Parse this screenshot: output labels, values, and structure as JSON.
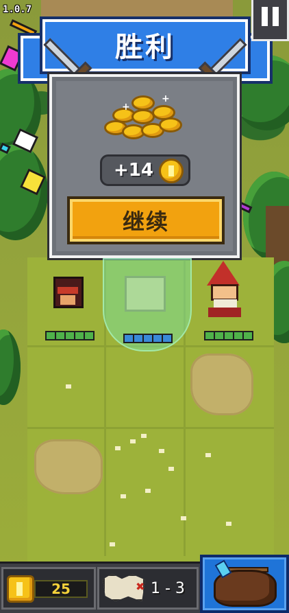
{
  "game": {
    "version": "1.0.7",
    "banner_title": "胜利",
    "reward": {
      "amount_label": "+14",
      "icon": "gold-coin-icon"
    },
    "continue_label": "继续",
    "pause_icon": "pause-icon"
  },
  "heroes": [
    {
      "name": "knight",
      "health_segments": 5,
      "health_color": "#4fb24a"
    },
    {
      "name": "ghost-hero",
      "health_segments": 5,
      "health_color": "#3a8ad8"
    },
    {
      "name": "wizard",
      "health_segments": 5,
      "health_color": "#4fb24a"
    }
  ],
  "hud": {
    "gold_count": "25",
    "stage_label": "1 - 3",
    "map_icon": "map-icon",
    "inventory_icon": "bag-icon"
  },
  "colors": {
    "banner_blue": "#2f7fe6",
    "button_orange": "#f2a20f",
    "panel_gray": "#7b7f86",
    "gold": "#f6c218"
  }
}
